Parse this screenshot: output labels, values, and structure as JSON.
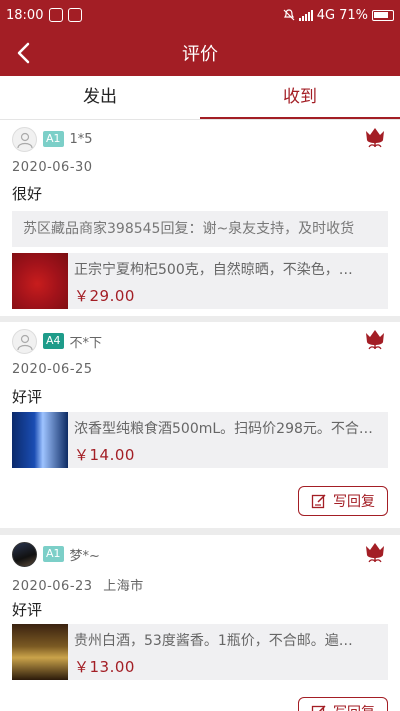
{
  "status": {
    "time": "18:00",
    "network": "4G",
    "battery": "71%"
  },
  "header": {
    "title": "评价"
  },
  "tabs": [
    {
      "label": "发出"
    },
    {
      "label": "收到"
    }
  ],
  "reviews": [
    {
      "badge": "A1",
      "username": "1*5",
      "date": "2020-06-30",
      "location": "",
      "comment": "很好",
      "seller_reply": "苏区藏品商家398545回复：谢~泉友支持，及时收货",
      "product": {
        "name": "正宗宁夏枸杞500克，自然晾晒，不染色，…",
        "price": "￥29.00"
      }
    },
    {
      "badge": "A4",
      "username": "不*下",
      "date": "2020-06-25",
      "location": "",
      "comment": "好评",
      "product": {
        "name": "浓香型纯粮食酒500mL。扫码价298元。不合…",
        "price": "￥14.00"
      },
      "reply_button": "写回复"
    },
    {
      "badge": "A1",
      "username": "梦*~",
      "date": "2020-06-23",
      "location": "上海市",
      "comment": "好评",
      "product": {
        "name": "贵州白酒，53度酱香。1瓶价，不合邮。遍…",
        "price": "￥13.00"
      },
      "reply_button": "写回复"
    }
  ],
  "colors": {
    "brand": "#a31e25",
    "badge_a1": "#7ccfc8",
    "badge_a4": "#1e9c8a"
  }
}
